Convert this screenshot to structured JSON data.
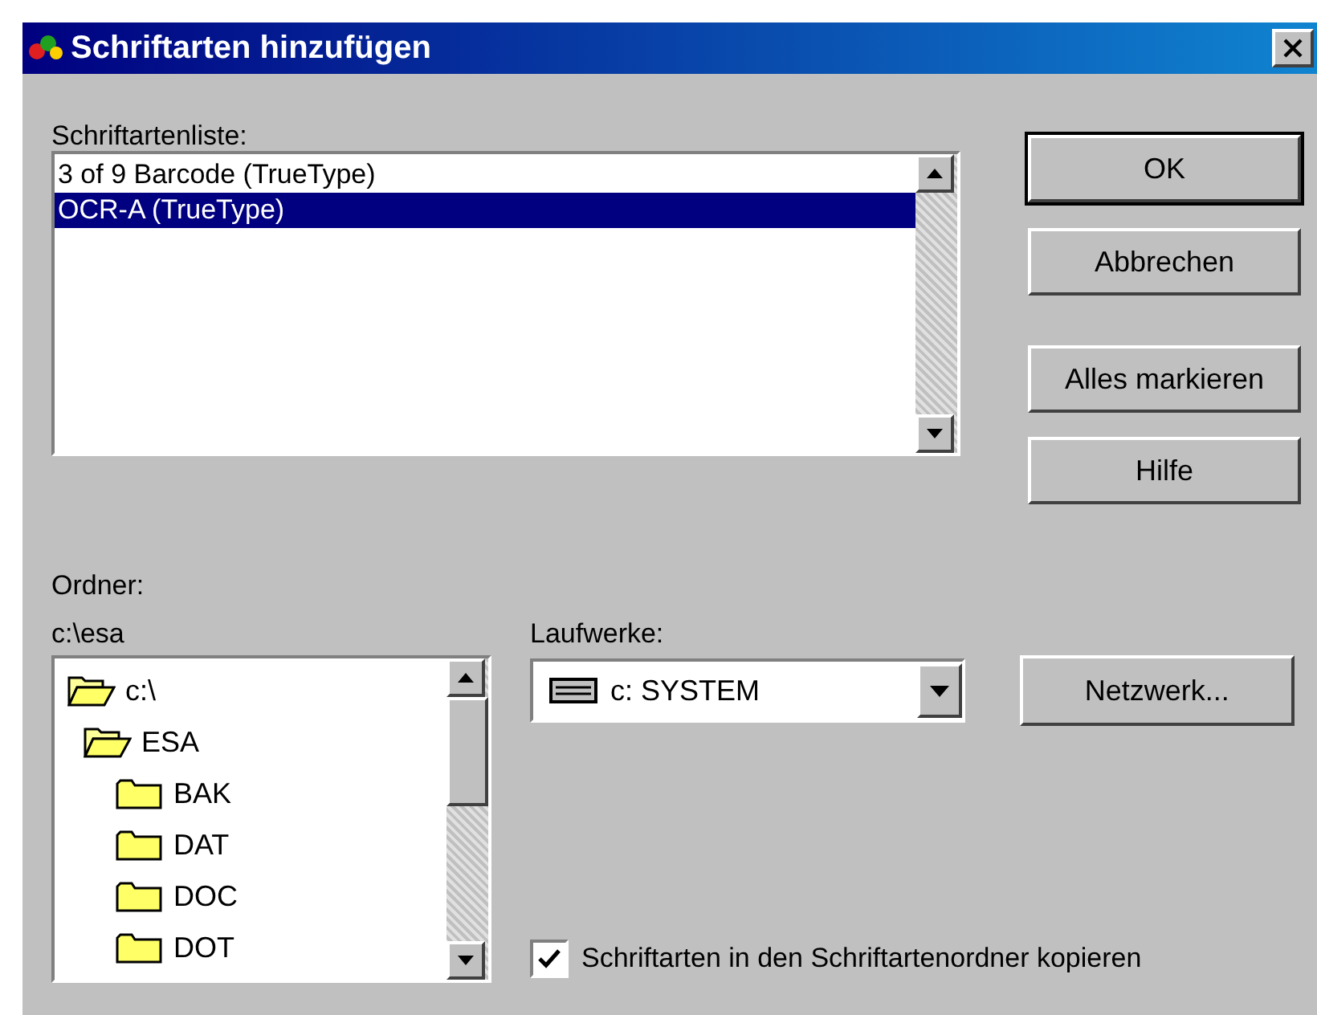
{
  "window": {
    "title": "Schriftarten hinzufügen"
  },
  "font_list": {
    "label": "Schriftartenliste:",
    "items": [
      {
        "label": "3 of 9 Barcode (TrueType)",
        "selected": false
      },
      {
        "label": "OCR-A (TrueType)",
        "selected": true
      }
    ]
  },
  "buttons": [
    {
      "label": "OK",
      "default": true
    },
    {
      "label": "Abbrechen",
      "default": false
    },
    {
      "label": "Alles markieren",
      "default": false
    },
    {
      "label": "Hilfe",
      "default": false
    }
  ],
  "folders": {
    "label": "Ordner:",
    "path": "c:\\esa",
    "tree": [
      {
        "label": "c:\\",
        "expanded": true,
        "children": [
          {
            "label": "ESA",
            "expanded": true,
            "children": [
              {
                "label": "BAK",
                "expanded": false
              },
              {
                "label": "DAT",
                "expanded": false
              },
              {
                "label": "DOC",
                "expanded": false
              },
              {
                "label": "DOT",
                "expanded": false
              }
            ]
          }
        ]
      }
    ]
  },
  "drives": {
    "label": "Laufwerke:",
    "value": "c: SYSTEM"
  },
  "network_button": {
    "label": "Netzwerk..."
  },
  "copy_checkbox": {
    "label": "Schriftarten in den Schriftartenordner kopieren",
    "checked": true
  }
}
